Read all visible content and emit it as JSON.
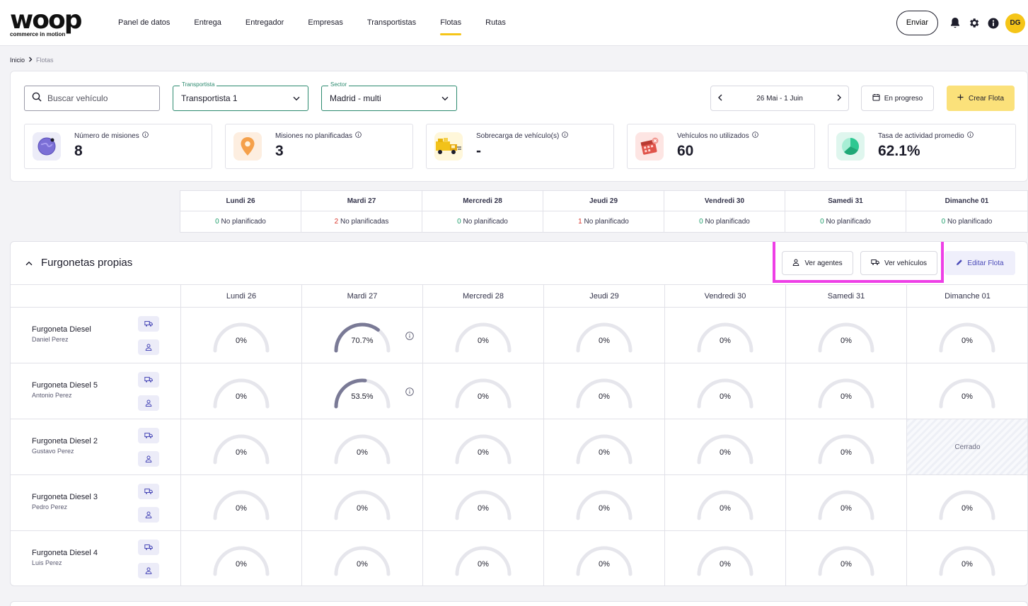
{
  "brand": {
    "name": "woop",
    "tagline": "commerce in motion"
  },
  "nav": {
    "items": [
      "Panel de datos",
      "Entrega",
      "Entregador",
      "Empresas",
      "Transportistas",
      "Flotas",
      "Rutas"
    ],
    "active": "Flotas"
  },
  "topbar": {
    "send_label": "Enviar",
    "avatar_initials": "DG"
  },
  "breadcrumb": {
    "home": "Inicio",
    "current": "Flotas"
  },
  "filters": {
    "search_placeholder": "Buscar vehículo",
    "carrier": {
      "label": "Transportista",
      "value": "Transportista 1"
    },
    "sector": {
      "label": "Sector",
      "value": "Madrid - multi"
    },
    "date_range": "26 Mai - 1 Juin",
    "status": "En progreso",
    "create_label": "Crear Flota"
  },
  "kpis": [
    {
      "label": "Número de misiones",
      "value": "8",
      "icon": "globe-icon"
    },
    {
      "label": "Misiones no planificadas",
      "value": "3",
      "icon": "pin-icon"
    },
    {
      "label": "Sobrecarga de vehículo(s)",
      "value": "-",
      "icon": "truck-icon"
    },
    {
      "label": "Vehículos no utilizados",
      "value": "60",
      "icon": "calendar-icon"
    },
    {
      "label": "Tasa de actividad promedio",
      "value": "62.1%",
      "icon": "pie-icon"
    }
  ],
  "days": [
    "Lundi 26",
    "Mardi 27",
    "Mercredi 28",
    "Jeudi 29",
    "Vendredi 30",
    "Samedi 31",
    "Dimanche 01"
  ],
  "unplanned": [
    {
      "count": "0",
      "text": "No planificado",
      "tone": "green"
    },
    {
      "count": "2",
      "text": "No planificadas",
      "tone": "red"
    },
    {
      "count": "0",
      "text": "No planificado",
      "tone": "green"
    },
    {
      "count": "1",
      "text": "No planificado",
      "tone": "red"
    },
    {
      "count": "0",
      "text": "No planificado",
      "tone": "green"
    },
    {
      "count": "0",
      "text": "No planificado",
      "tone": "green"
    },
    {
      "count": "0",
      "text": "No planificado",
      "tone": "green"
    }
  ],
  "fleet": {
    "title": "Furgonetas propias",
    "view_agents_label": "Ver agentes",
    "view_vehicles_label": "Ver vehículos",
    "edit_label": "Editar Flota",
    "closed_label": "Cerrado",
    "vehicles": [
      {
        "name": "Furgoneta Diesel",
        "agent": "Daniel Perez",
        "load": [
          0,
          70.7,
          0,
          0,
          0,
          0,
          0
        ],
        "labels": [
          "0%",
          "70.7%",
          "0%",
          "0%",
          "0%",
          "0%",
          "0%"
        ],
        "info": [
          false,
          true,
          false,
          false,
          false,
          false,
          false
        ],
        "closed": [
          false,
          false,
          false,
          false,
          false,
          false,
          false
        ]
      },
      {
        "name": "Furgoneta Diesel 5",
        "agent": "Antonio Perez",
        "load": [
          0,
          53.5,
          0,
          0,
          0,
          0,
          0
        ],
        "labels": [
          "0%",
          "53.5%",
          "0%",
          "0%",
          "0%",
          "0%",
          "0%"
        ],
        "info": [
          false,
          true,
          false,
          false,
          false,
          false,
          false
        ],
        "closed": [
          false,
          false,
          false,
          false,
          false,
          false,
          false
        ]
      },
      {
        "name": "Furgoneta Diesel 2",
        "agent": "Gustavo Perez",
        "load": [
          0,
          0,
          0,
          0,
          0,
          0,
          0
        ],
        "labels": [
          "0%",
          "0%",
          "0%",
          "0%",
          "0%",
          "0%",
          ""
        ],
        "info": [
          false,
          false,
          false,
          false,
          false,
          false,
          false
        ],
        "closed": [
          false,
          false,
          false,
          false,
          false,
          false,
          true
        ]
      },
      {
        "name": "Furgoneta Diesel 3",
        "agent": "Pedro Perez",
        "load": [
          0,
          0,
          0,
          0,
          0,
          0,
          0
        ],
        "labels": [
          "0%",
          "0%",
          "0%",
          "0%",
          "0%",
          "0%",
          "0%"
        ],
        "info": [
          false,
          false,
          false,
          false,
          false,
          false,
          false
        ],
        "closed": [
          false,
          false,
          false,
          false,
          false,
          false,
          false
        ]
      },
      {
        "name": "Furgoneta Diesel 4",
        "agent": "Luis Perez",
        "load": [
          0,
          0,
          0,
          0,
          0,
          0,
          0
        ],
        "labels": [
          "0%",
          "0%",
          "0%",
          "0%",
          "0%",
          "0%",
          "0%"
        ],
        "info": [
          false,
          false,
          false,
          false,
          false,
          false,
          false
        ],
        "closed": [
          false,
          false,
          false,
          false,
          false,
          false,
          false
        ]
      }
    ]
  },
  "colors": {
    "accent": "#f5c518",
    "green": "#2c8a6f",
    "gauge_fill": "#7a7a96",
    "gauge_track": "#e6e6ec",
    "highlight": "#ee3fe6"
  }
}
